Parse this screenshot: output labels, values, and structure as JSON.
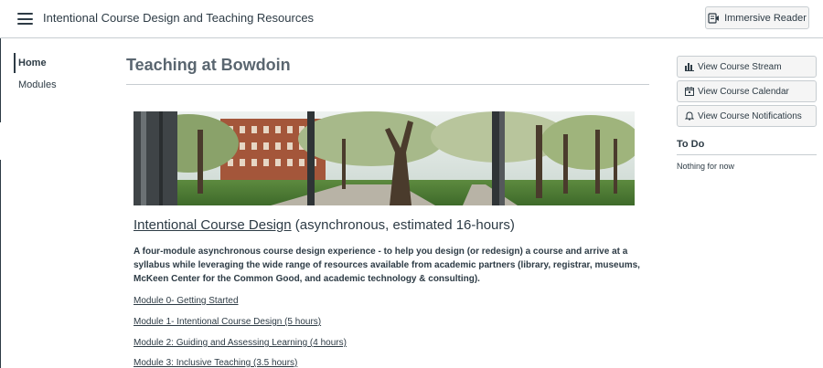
{
  "header": {
    "course_title": "Intentional Course Design and Teaching Resources",
    "immersive_reader_label": "Immersive Reader"
  },
  "nav": {
    "items": [
      {
        "label": "Home",
        "active": true
      },
      {
        "label": "Modules",
        "active": false
      }
    ]
  },
  "main": {
    "page_title": "Teaching at Bowdoin",
    "section": {
      "link_text": "Intentional Course Design",
      "suffix": " (asynchronous, estimated 16-hours)"
    },
    "description": "A four-module asynchronous course design experience - to help you design (or redesign) a course and arrive at a syllabus while leveraging the wide range of resources available from academic partners (library, registrar, museums, McKeen Center for the Common Good, and academic technology & consulting).",
    "modules": [
      "Module 0- Getting Started",
      "Module 1- Intentional Course Design (5 hours)",
      "Module 2: Guiding and Assessing Learning (4 hours)",
      "Module 3: Inclusive Teaching (3.5 hours)"
    ]
  },
  "sidebar": {
    "buttons": {
      "stream": "View Course Stream",
      "calendar": "View Course Calendar",
      "notifications": "View Course Notifications"
    },
    "todo_title": "To Do",
    "todo_empty": "Nothing for now"
  },
  "colors": {
    "text": "#2d3b45",
    "muted_title": "#5a6670",
    "border": "#c7cdd1",
    "button_bg": "#f5f5f5"
  },
  "icons": [
    "hamburger-icon",
    "immersive-reader-icon",
    "stream-icon",
    "calendar-icon",
    "bell-icon"
  ]
}
